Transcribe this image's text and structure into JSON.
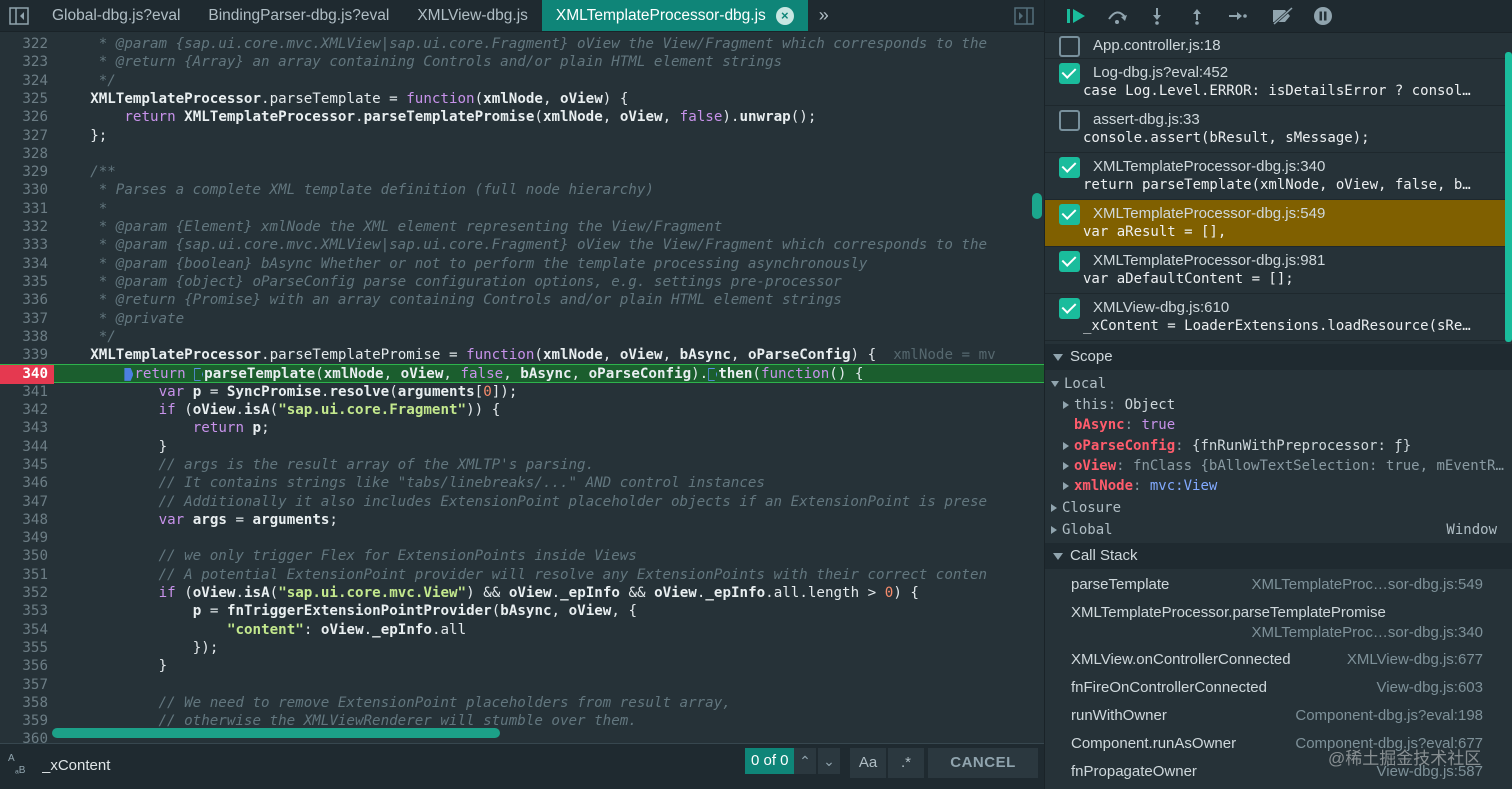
{
  "tabs": [
    {
      "label": "Global-dbg.js?eval",
      "active": false
    },
    {
      "label": "BindingParser-dbg.js?eval",
      "active": false
    },
    {
      "label": "XMLView-dbg.js",
      "active": false
    },
    {
      "label": "XMLTemplateProcessor-dbg.js",
      "active": true
    }
  ],
  "tab_close_glyph": "×",
  "tab_more_glyph": "»",
  "icons": {
    "sidebar_toggle": "sidebar-toggle-icon",
    "panel_toggle": "panel-toggle-icon",
    "resume": "resume-icon",
    "step_over": "step-over-icon",
    "step_into": "step-into-icon",
    "step_out": "step-out-icon",
    "step": "step-icon",
    "deactivate_breakpoints": "deactivate-breakpoints-icon",
    "pause_on_exceptions": "pause-on-exceptions-icon"
  },
  "colors": {
    "accent": "#0f8578",
    "current_line": "#1b5e2e",
    "breakpoint_gutter": "#e53950",
    "paused_breakpoint": "#806000"
  },
  "editor": {
    "current_line": 340,
    "lines": [
      {
        "n": "322",
        "text": "     * @param {sap.ui.core.mvc.XMLView|sap.ui.core.Fragment} oView the View/Fragment which corresponds to the"
      },
      {
        "n": "323",
        "text": "     * @return {Array} an array containing Controls and/or plain HTML element strings"
      },
      {
        "n": "324",
        "text": "     */"
      },
      {
        "n": "325",
        "text": "    XMLTemplateProcessor.parseTemplate = function(xmlNode, oView) {"
      },
      {
        "n": "326",
        "text": "        return XMLTemplateProcessor.parseTemplatePromise(xmlNode, oView, false).unwrap();"
      },
      {
        "n": "327",
        "text": "    };"
      },
      {
        "n": "328",
        "text": ""
      },
      {
        "n": "329",
        "text": "    /**"
      },
      {
        "n": "330",
        "text": "     * Parses a complete XML template definition (full node hierarchy)"
      },
      {
        "n": "331",
        "text": "     *"
      },
      {
        "n": "332",
        "text": "     * @param {Element} xmlNode the XML element representing the View/Fragment"
      },
      {
        "n": "333",
        "text": "     * @param {sap.ui.core.mvc.XMLView|sap.ui.core.Fragment} oView the View/Fragment which corresponds to the"
      },
      {
        "n": "334",
        "text": "     * @param {boolean} bAsync Whether or not to perform the template processing asynchronously"
      },
      {
        "n": "335",
        "text": "     * @param {object} oParseConfig parse configuration options, e.g. settings pre-processor"
      },
      {
        "n": "336",
        "text": "     * @return {Promise} with an array containing Controls and/or plain HTML element strings"
      },
      {
        "n": "337",
        "text": "     * @private"
      },
      {
        "n": "338",
        "text": "     */"
      },
      {
        "n": "339",
        "text": "    XMLTemplateProcessor.parseTemplatePromise = function(xmlNode, oView, bAsync, oParseConfig) {",
        "hint": "xmlNode = mv"
      },
      {
        "n": "340",
        "text": "        return parseTemplate(xmlNode, oView, false, bAsync, oParseConfig).then(function() {"
      },
      {
        "n": "341",
        "text": "            var p = SyncPromise.resolve(arguments[0]);"
      },
      {
        "n": "342",
        "text": "            if (oView.isA(\"sap.ui.core.Fragment\")) {"
      },
      {
        "n": "343",
        "text": "                return p;"
      },
      {
        "n": "344",
        "text": "            }"
      },
      {
        "n": "345",
        "text": "            // args is the result array of the XMLTP's parsing."
      },
      {
        "n": "346",
        "text": "            // It contains strings like \"tabs/linebreaks/...\" AND control instances"
      },
      {
        "n": "347",
        "text": "            // Additionally it also includes ExtensionPoint placeholder objects if an ExtensionPoint is prese"
      },
      {
        "n": "348",
        "text": "            var args = arguments;"
      },
      {
        "n": "349",
        "text": ""
      },
      {
        "n": "350",
        "text": "            // we only trigger Flex for ExtensionPoints inside Views"
      },
      {
        "n": "351",
        "text": "            // A potential ExtensionPoint provider will resolve any ExtensionPoints with their correct conten"
      },
      {
        "n": "352",
        "text": "            if (oView.isA(\"sap.ui.core.mvc.View\") && oView._epInfo && oView._epInfo.all.length > 0) {"
      },
      {
        "n": "353",
        "text": "                p = fnTriggerExtensionPointProvider(bAsync, oView, {"
      },
      {
        "n": "354",
        "text": "                    \"content\": oView._epInfo.all"
      },
      {
        "n": "355",
        "text": "                });"
      },
      {
        "n": "356",
        "text": "            }"
      },
      {
        "n": "357",
        "text": ""
      },
      {
        "n": "358",
        "text": "            // We need to remove ExtensionPoint placeholders from result array,"
      },
      {
        "n": "359",
        "text": "            // otherwise the XMLViewRenderer will stumble over them."
      },
      {
        "n": "360",
        "text": ""
      }
    ]
  },
  "search": {
    "case_label_top": "A",
    "case_label_bottom": "ₐB",
    "value": "_xContent",
    "match_count": "0 of 0",
    "prev_glyph": "⌃",
    "next_glyph": "⌄",
    "match_case_label": "Aa",
    "regex_label": ".*",
    "cancel_label": "CANCEL"
  },
  "breakpoints": [
    {
      "file": "App.controller.js:18",
      "code": "",
      "checked": false,
      "hit": false
    },
    {
      "file": "Log-dbg.js?eval:452",
      "code": "case Log.Level.ERROR: isDetailsError ? consol…",
      "checked": true,
      "hit": false
    },
    {
      "file": "assert-dbg.js:33",
      "code": "console.assert(bResult, sMessage);",
      "checked": false,
      "hit": false
    },
    {
      "file": "XMLTemplateProcessor-dbg.js:340",
      "code": "return parseTemplate(xmlNode, oView, false, b…",
      "checked": true,
      "hit": false
    },
    {
      "file": "XMLTemplateProcessor-dbg.js:549",
      "code": "var aResult = [],",
      "checked": true,
      "hit": true
    },
    {
      "file": "XMLTemplateProcessor-dbg.js:981",
      "code": "var aDefaultContent = [];",
      "checked": true,
      "hit": false
    },
    {
      "file": "XMLView-dbg.js:610",
      "code": "_xContent = LoaderExtensions.loadResource(sRe…",
      "checked": true,
      "hit": false
    }
  ],
  "scope": {
    "title": "Scope",
    "local_label": "Local",
    "this_name": "this",
    "this_value": "Object",
    "bAsync_name": "bAsync",
    "bAsync_value": "true",
    "oParseConfig_name": "oParseConfig",
    "oParseConfig_value": "{fnRunWithPreprocessor: ƒ}",
    "oView_name": "oView",
    "oView_value_class": "fnClass",
    "oView_value_rest": "{bAllowTextSelection: true, mEventR…",
    "xmlNode_name": "xmlNode",
    "xmlNode_value": "mvc:View",
    "closure_label": "Closure",
    "global_label": "Global",
    "global_value": "Window"
  },
  "call_stack": {
    "title": "Call Stack",
    "frames": [
      {
        "fn": "parseTemplate",
        "loc": "XMLTemplateProc…sor-dbg.js:549"
      },
      {
        "fn": "XMLTemplateProcessor.parseTemplatePromise",
        "loc": "XMLTemplateProc…sor-dbg.js:340"
      },
      {
        "fn": "XMLView.onControllerConnected",
        "loc": "XMLView-dbg.js:677"
      },
      {
        "fn": "fnFireOnControllerConnected",
        "loc": "View-dbg.js:603"
      },
      {
        "fn": "runWithOwner",
        "loc": "Component-dbg.js?eval:198"
      },
      {
        "fn": "Component.runAsOwner",
        "loc": "Component-dbg.js?eval:677"
      },
      {
        "fn": "fnPropagateOwner",
        "loc": "View-dbg.js:587"
      }
    ]
  },
  "watermark": "@稀土掘金技术社区"
}
